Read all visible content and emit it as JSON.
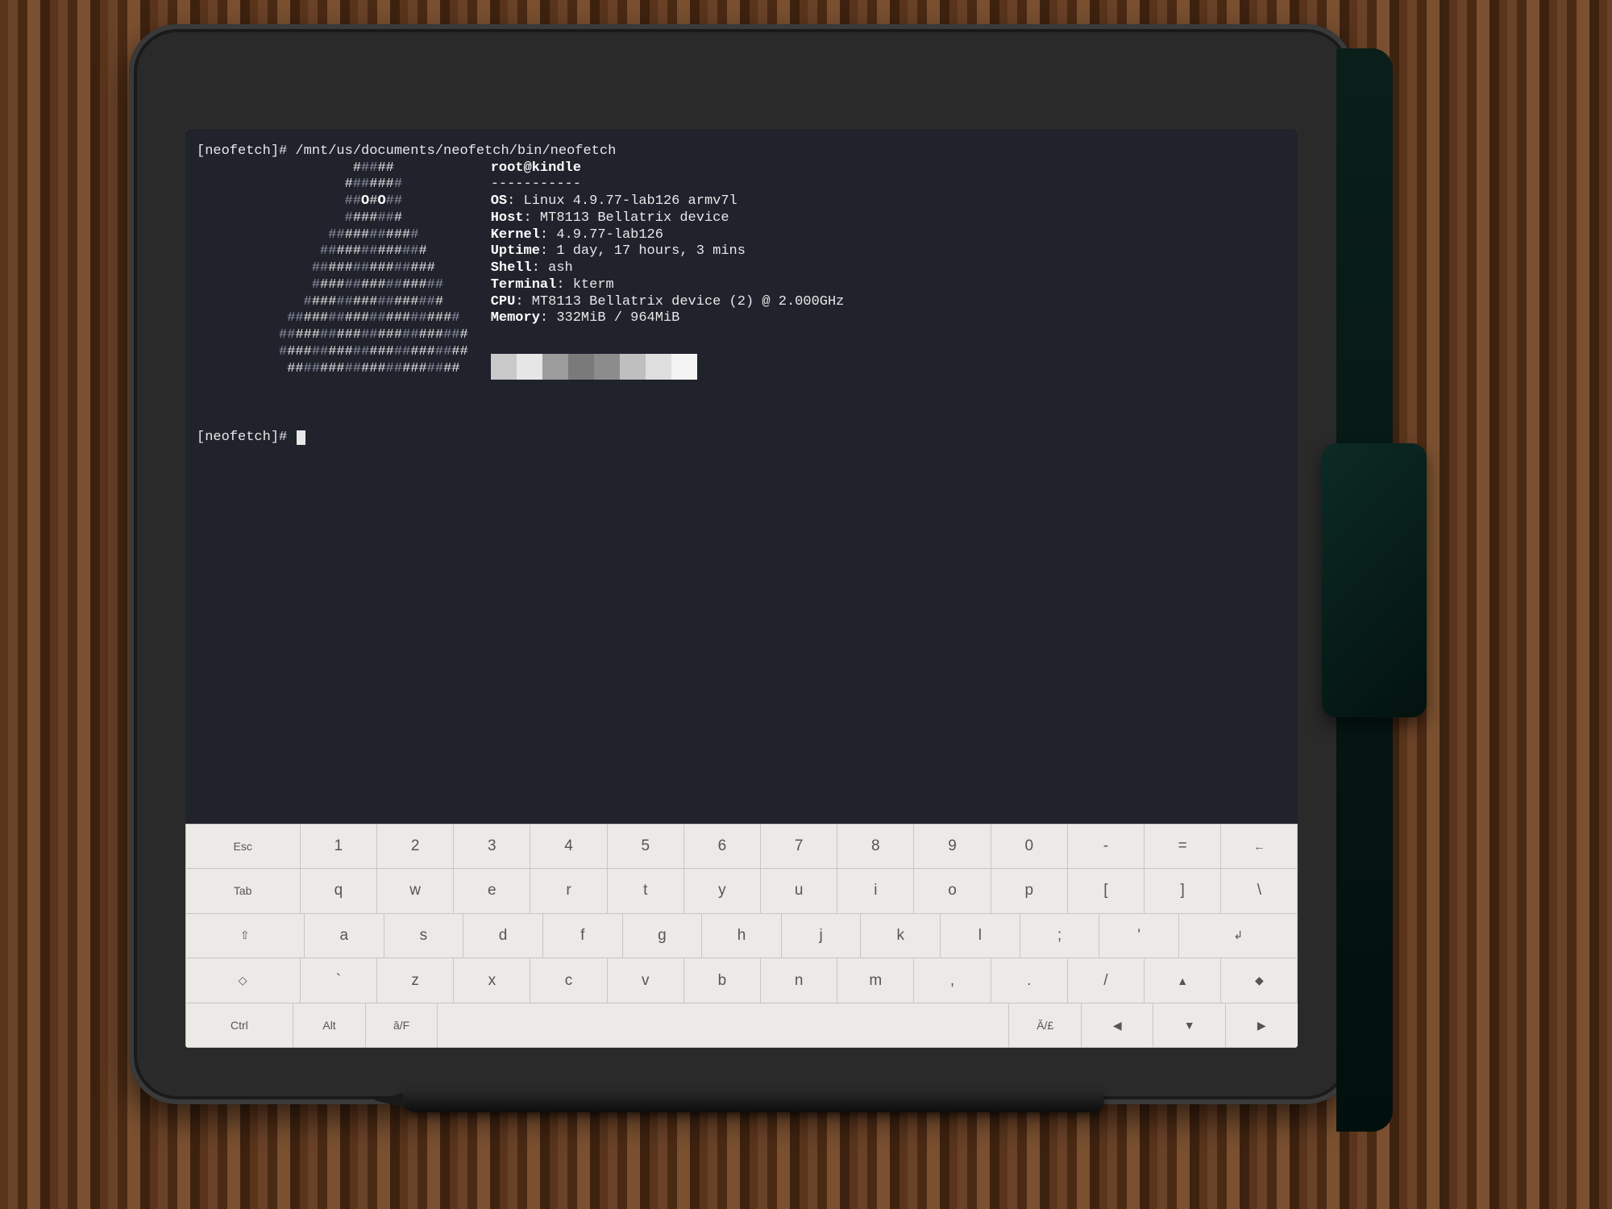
{
  "terminal": {
    "prompt1_prefix": "[neofetch]# ",
    "command": "/mnt/us/documents/neofetch/bin/neofetch",
    "ascii": [
      "                   #####",
      "                  #######",
      "                  ##O#O##",
      "                  #######",
      "                ###########",
      "               #############",
      "              ###############",
      "              ################",
      "             #################",
      "           #####################",
      "          #######################",
      "          #######################",
      "           #####################"
    ],
    "ascii_dim_positions": "mixed",
    "header": "root@kindle",
    "divider": "-----------",
    "info": [
      {
        "label": "OS",
        "value": "Linux 4.9.77-lab126 armv7l"
      },
      {
        "label": "Host",
        "value": "MT8113 Bellatrix device"
      },
      {
        "label": "Kernel",
        "value": "4.9.77-lab126"
      },
      {
        "label": "Uptime",
        "value": "1 day, 17 hours, 3 mins"
      },
      {
        "label": "Shell",
        "value": "ash"
      },
      {
        "label": "Terminal",
        "value": "kterm"
      },
      {
        "label": "CPU",
        "value": "MT8113 Bellatrix device (2) @ 2.000GHz"
      },
      {
        "label": "Memory",
        "value": "332MiB / 964MiB"
      }
    ],
    "swatch_colors": [
      "#c9c9c9",
      "#e6e6e6",
      "#9c9c9c",
      "#7a7a7a",
      "#8c8c8c",
      "#bfbfbf",
      "#dedede",
      "#f3f3f3"
    ],
    "prompt2": "[neofetch]# "
  },
  "keyboard": {
    "rows": [
      [
        "Esc",
        "1",
        "2",
        "3",
        "4",
        "5",
        "6",
        "7",
        "8",
        "9",
        "0",
        "-",
        "=",
        "←"
      ],
      [
        "Tab",
        "q",
        "w",
        "e",
        "r",
        "t",
        "y",
        "u",
        "i",
        "o",
        "p",
        "[",
        "]",
        "\\"
      ],
      [
        "⇧",
        "a",
        "s",
        "d",
        "f",
        "g",
        "h",
        "j",
        "k",
        "l",
        ";",
        "'",
        "↲"
      ],
      [
        "◇",
        "`",
        "z",
        "x",
        "c",
        "v",
        "b",
        "n",
        "m",
        ",",
        ".",
        "/",
        "▲",
        "◆"
      ],
      [
        "Ctrl",
        "Alt",
        "ă/F",
        " ",
        "Ă/£",
        "◀",
        "▼",
        "▶"
      ]
    ],
    "wide_keys_row4_space_index": 3
  }
}
